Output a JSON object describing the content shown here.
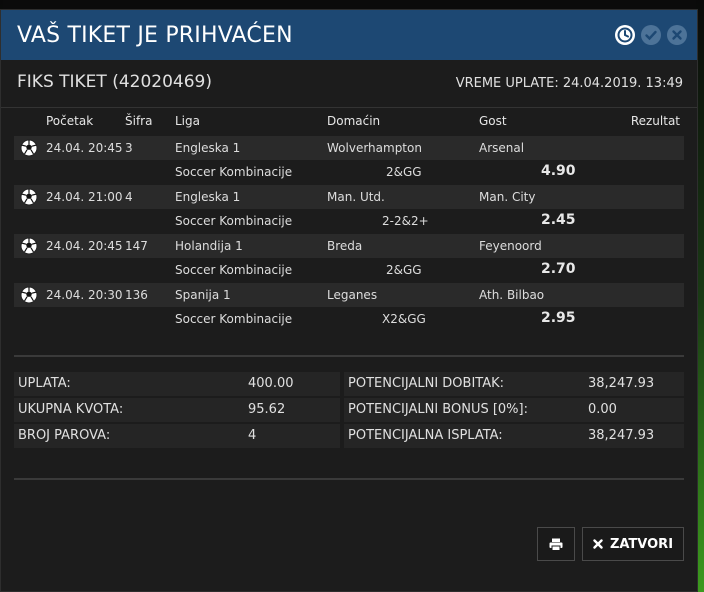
{
  "header": {
    "title": "VAŠ TIKET JE PRIHVAĆEN"
  },
  "ticket": {
    "title": "FIKS TIKET (42020469)",
    "payment_time": "VREME UPLATE: 24.04.2019. 13:49"
  },
  "table": {
    "headers": {
      "start": "Početak",
      "code": "Šifra",
      "league": "Liga",
      "home": "Domaćin",
      "away": "Gost",
      "result": "Rezultat"
    },
    "matches": [
      {
        "start": "24.04. 20:45",
        "code": "3",
        "league": "Engleska 1",
        "home": "Wolverhampton",
        "away": "Arsenal",
        "bet_type": "Soccer Kombinacije",
        "pick": "2&GG",
        "odds": "4.90"
      },
      {
        "start": "24.04. 21:00",
        "code": "4",
        "league": "Engleska 1",
        "home": "Man. Utd.",
        "away": "Man. City",
        "bet_type": "Soccer Kombinacije",
        "pick": "2-2&2+",
        "odds": "2.45"
      },
      {
        "start": "24.04. 20:45",
        "code": "147",
        "league": "Holandija 1",
        "home": "Breda",
        "away": "Feyenoord",
        "bet_type": "Soccer Kombinacije",
        "pick": "2&GG",
        "odds": "2.70"
      },
      {
        "start": "24.04. 20:30",
        "code": "136",
        "league": "Spanija 1",
        "home": "Leganes",
        "away": "Ath. Bilbao",
        "bet_type": "Soccer Kombinacije",
        "pick": "X2&GG",
        "odds": "2.95"
      }
    ]
  },
  "summary": {
    "stake_label": "UPLATA:",
    "stake_value": "400.00",
    "total_odds_label": "UKUPNA KVOTA:",
    "total_odds_value": "95.62",
    "pairs_label": "BROJ PAROVA:",
    "pairs_value": "4",
    "potential_win_label": "POTENCIJALNI DOBITAK:",
    "potential_win_value": "38,247.93",
    "potential_bonus_label": "POTENCIJALNI BONUS [0%]:",
    "potential_bonus_value": "0.00",
    "potential_payout_label": "POTENCIJALNA ISPLATA:",
    "potential_payout_value": "38,247.93"
  },
  "buttons": {
    "close_label": "ZATVORI"
  },
  "icons": {
    "header": [
      "clock-icon",
      "check-icon",
      "close-icon"
    ],
    "row": "soccer-ball-icon",
    "print": "printer-icon",
    "close_button": "x-icon"
  },
  "colors": {
    "header_bg": "#1d4873",
    "modal_bg": "#1c1c1c",
    "row_bg": "#2a2a2a"
  }
}
